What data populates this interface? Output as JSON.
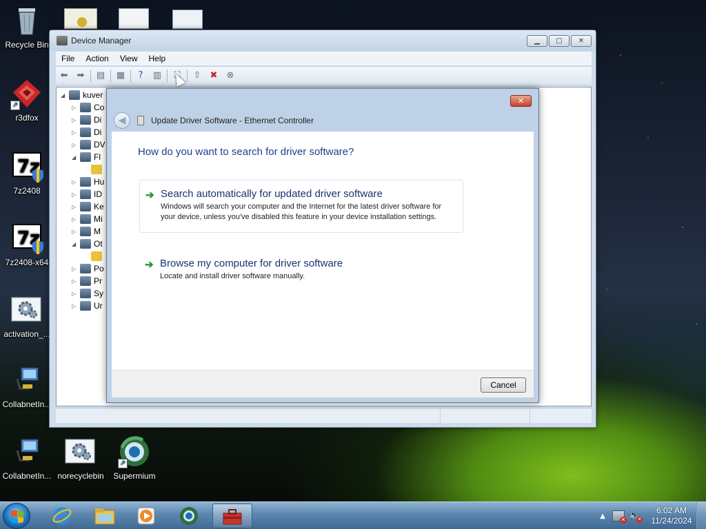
{
  "desktop": {
    "icons": [
      {
        "label": "Recycle Bin",
        "icon": "recycle-bin-icon"
      },
      {
        "label": "r3dfox",
        "icon": "r3dfox-icon"
      },
      {
        "label": "7z2408",
        "icon": "7zip-installer-icon"
      },
      {
        "label": "7z2408-x64",
        "icon": "7zip-installer-icon"
      },
      {
        "label": "activation_...",
        "icon": "gear-settings-icon"
      },
      {
        "label": "CollabnetIn...",
        "icon": "network-computer-icon"
      },
      {
        "label": "CollabnetIn...",
        "icon": "network-computer-icon"
      },
      {
        "label": "norecyclebin",
        "icon": "gear-settings-icon"
      },
      {
        "label": "Supermium",
        "icon": "supermium-browser-icon"
      }
    ]
  },
  "device_manager": {
    "title": "Device Manager",
    "menu": [
      "File",
      "Action",
      "View",
      "Help"
    ],
    "window_buttons": [
      "minimize",
      "maximize",
      "close"
    ],
    "toolbar": [
      "back",
      "forward",
      "show-hide-console-tree",
      "properties",
      "help",
      "action-pane",
      "scan-hardware-changes",
      "update-driver",
      "disable-device",
      "uninstall-device"
    ],
    "tree_root": "kuver",
    "tree_items": [
      "Co",
      "Di",
      "Di",
      "DV",
      "Fl",
      "",
      "Hu",
      "ID",
      "Ke",
      "Mi",
      "M",
      "Ot",
      "",
      "Po",
      "Pr",
      "Sy",
      "Ur"
    ]
  },
  "dialog": {
    "title": "Update Driver Software - Ethernet Controller",
    "question": "How do you want to search for driver software?",
    "options": [
      {
        "title": "Search automatically for updated driver software",
        "description": "Windows will search your computer and the Internet for the latest driver software for your device, unless you've disabled this feature in your device installation settings."
      },
      {
        "title": "Browse my computer for driver software",
        "description": "Locate and install driver software manually."
      }
    ],
    "cancel_label": "Cancel",
    "close_glyph": "✕"
  },
  "taskbar": {
    "pinned": [
      "internet-explorer-icon",
      "file-explorer-icon",
      "media-player-icon",
      "supermium-browser-icon",
      "device-manager-toolbox-icon"
    ],
    "time": "6:02 AM",
    "date": "11/24/2024"
  },
  "colors": {
    "dialog_heading": "#1b3f8a",
    "option_title": "#15336e",
    "arrow_green": "#1c9b2d",
    "close_red": "#c8432a"
  }
}
